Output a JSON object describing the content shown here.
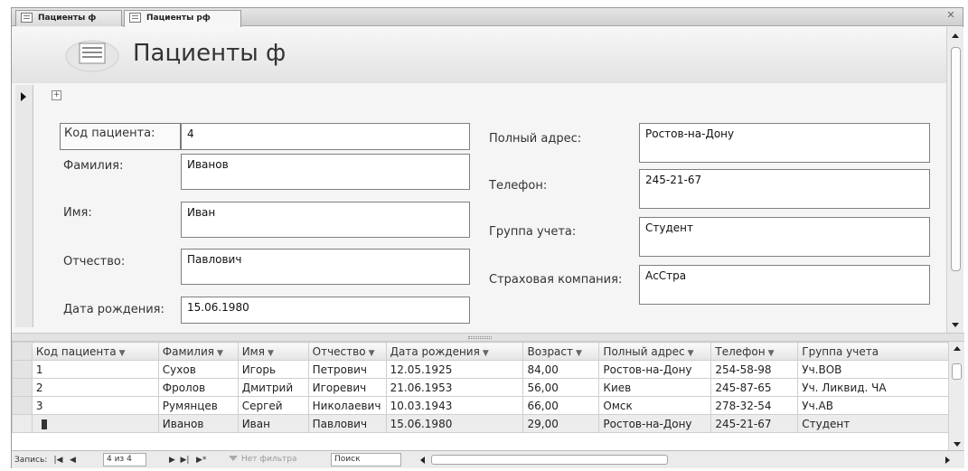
{
  "tabs": [
    {
      "label": "Пациенты ф"
    },
    {
      "label": "Пациенты рф"
    }
  ],
  "form": {
    "title": "Пациенты ф",
    "left_fields": [
      {
        "label": "Код пациента:",
        "value": "4"
      },
      {
        "label": "Фамилия:",
        "value": "Иванов"
      },
      {
        "label": "Имя:",
        "value": "Иван"
      },
      {
        "label": "Отчество:",
        "value": "Павлович"
      },
      {
        "label": "Дата рождения:",
        "value": "15.06.1980"
      }
    ],
    "right_fields": [
      {
        "label": "Полный адрес:",
        "value": "Ростов-на-Дону"
      },
      {
        "label": "Телефон:",
        "value": "245-21-67"
      },
      {
        "label": "Группа учета:",
        "value": "Студент"
      },
      {
        "label": "Страховая компания:",
        "value": "АсСтра"
      }
    ]
  },
  "datasheet": {
    "columns": [
      "Код пациента",
      "Фамилия",
      "Имя",
      "Отчество",
      "Дата рождения",
      "Возраст",
      "Полный адрес",
      "Телефон",
      "Группа учета"
    ],
    "rows": [
      [
        "1",
        "Сухов",
        "Игорь",
        "Петрович",
        "12.05.1925",
        "84,00",
        "Ростов-на-Дону",
        "254-58-98",
        "Уч.ВОВ"
      ],
      [
        "2",
        "Фролов",
        "Дмитрий",
        "Игоревич",
        "21.06.1953",
        "56,00",
        "Киев",
        "245-87-65",
        "Уч. Ликвид. ЧА"
      ],
      [
        "3",
        "Румянцев",
        "Сергей",
        "Николаевич",
        "10.03.1943",
        "66,00",
        "Омск",
        "278-32-54",
        "Уч.АВ"
      ],
      [
        "",
        "Иванов",
        "Иван",
        "Павлович",
        "15.06.1980",
        "29,00",
        "Ростов-на-Дону",
        "245-21-67",
        "Студент"
      ]
    ]
  },
  "navbar": {
    "records_label": "Запись:",
    "position": "4 из 4",
    "filter_label": "Нет фильтра",
    "search_placeholder": "Поиск"
  }
}
